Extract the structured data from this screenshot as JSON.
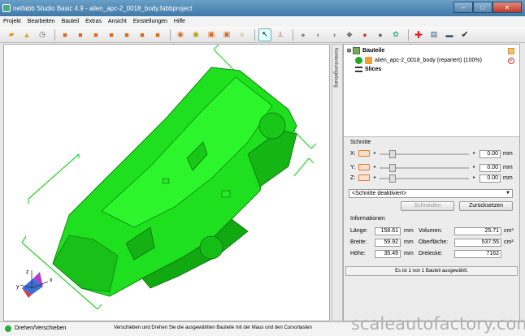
{
  "window": {
    "title": "netfabb Studio Basic 4.9 - alien_apc-2_0018_body.fabbproject"
  },
  "menu": [
    "Projekt",
    "Bearbeiten",
    "Bauteil",
    "Extras",
    "Ansicht",
    "Einstellungen",
    "Hilfe"
  ],
  "sidetab_label": "Kontextumgebung",
  "tree": {
    "parts_label": "Bauteile",
    "part_name": "alien_apc-2_0018_body (repariert) (100%)",
    "slices_label": "Slices"
  },
  "cuts": {
    "title": "Schnitte",
    "x_label": "X:",
    "y_label": "Y:",
    "z_label": "Z:",
    "x_value": "0.00",
    "y_value": "0.00",
    "z_value": "0.00",
    "unit": "mm",
    "mode": "<Schnitte deaktiviert>",
    "cut_button": "Schneiden",
    "reset_button": "Zurücksetzen"
  },
  "info": {
    "title": "Informationen",
    "length_label": "Länge:",
    "length_value": "158.61",
    "length_unit": "mm",
    "width_label": "Breite:",
    "width_value": "59.92",
    "width_unit": "mm",
    "height_label": "Höhe:",
    "height_value": "35.49",
    "height_unit": "mm",
    "volume_label": "Volumen:",
    "volume_value": "25.71",
    "volume_unit": "cm³",
    "surface_label": "Oberfläche:",
    "surface_value": "537.55",
    "surface_unit": "cm²",
    "triangles_label": "Dreiecke:",
    "triangles_value": "7162",
    "selection_text": "Es ist 1 von 1 Bauteil ausgewählt."
  },
  "status": {
    "mode": "Drehen/Verschieben",
    "hint": "Verschieben und Drehen Sie die ausgewählten Bauteile mit der Maus und den Cursortasten"
  },
  "axis_triad": {
    "x": "x",
    "y": "y",
    "z": "z"
  },
  "watermark": "scaleautofactory.com",
  "colors": {
    "model": "#1fe01f",
    "accent": "#3f79a8"
  }
}
